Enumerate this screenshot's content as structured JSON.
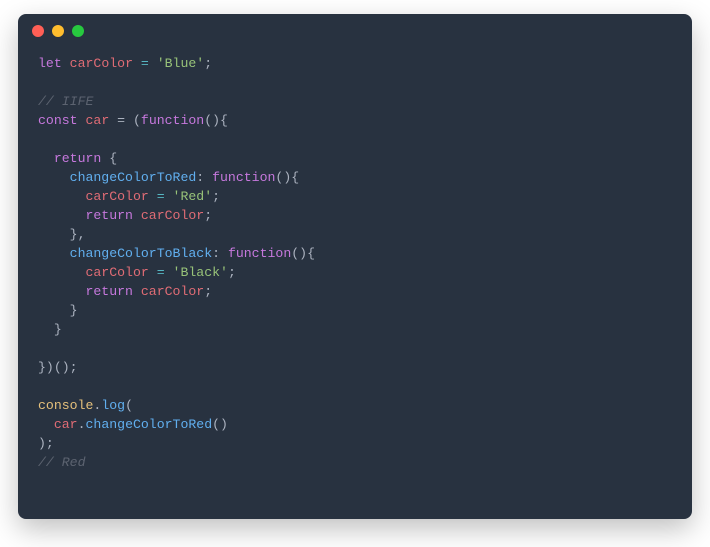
{
  "window": {
    "traffic_light_colors": {
      "close": "#ff5f56",
      "min": "#ffbd2e",
      "max": "#27c93f"
    },
    "background": "#283240"
  },
  "code": {
    "l1_let": "let",
    "l1_var": "carColor",
    "l1_eq": " = ",
    "l1_str": "'Blue'",
    "l1_sc": ";",
    "l3_comment": "// IIFE",
    "l4_const": "const",
    "l4_car": "car",
    "l4_eq": " = (",
    "l4_func": "function",
    "l4_rest": "(){",
    "l6_return": "return",
    "l6_brace": " {",
    "l7_name": "changeColorToRed",
    "l7_colon": ": ",
    "l7_func": "function",
    "l7_rest": "(){",
    "l8_var": "carColor",
    "l8_eq": " = ",
    "l8_str": "'Red'",
    "l8_sc": ";",
    "l9_return": "return",
    "l9_sp": " ",
    "l9_var": "carColor",
    "l9_sc": ";",
    "l10_close": "},",
    "l11_name": "changeColorToBlack",
    "l11_colon": ": ",
    "l11_func": "function",
    "l11_rest": "(){",
    "l12_var": "carColor",
    "l12_eq": " = ",
    "l12_str": "'Black'",
    "l12_sc": ";",
    "l13_return": "return",
    "l13_sp": " ",
    "l13_var": "carColor",
    "l13_sc": ";",
    "l14_close": "}",
    "l15_close": "}",
    "l17_close": "})();",
    "l19_console": "console",
    "l19_dot": ".",
    "l19_log": "log",
    "l19_open": "(",
    "l20_car": "car",
    "l20_dot": ".",
    "l20_fn": "changeColorToRed",
    "l20_call": "()",
    "l21_close": ");",
    "l22_comment": "// Red"
  }
}
